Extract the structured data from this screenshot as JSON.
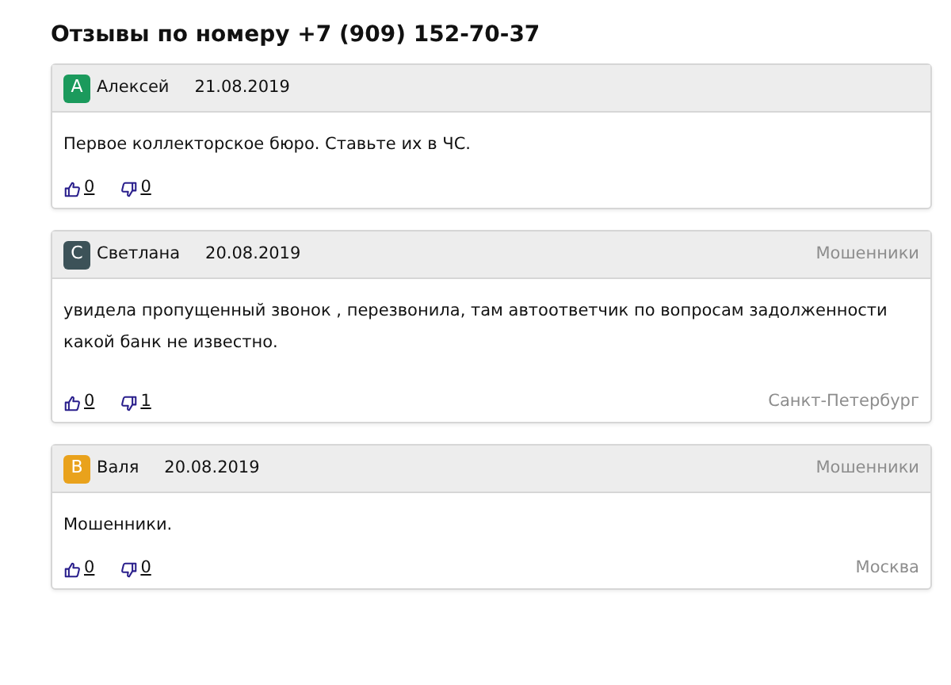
{
  "heading": "Отзывы по номеру +7 (909) 152-70-37",
  "reviews": [
    {
      "initial": "А",
      "color": "#1b9a5c",
      "author": "Алексей",
      "date": "21.08.2019",
      "text": "Первое коллекторское бюро. Ставьте их в ЧС.",
      "likes": "0",
      "dislikes": "0"
    },
    {
      "initial": "С",
      "color": "#3c5258",
      "author": "Светлана",
      "date": "20.08.2019",
      "category": "Мошенники",
      "text": "увидела пропущенный звонок , перезвонила, там автоответчик по вопросам задолженности какой банк не известно.",
      "likes": "0",
      "dislikes": "1",
      "city": "Санкт-Петербург"
    },
    {
      "initial": "В",
      "color": "#e9a21c",
      "author": "Валя",
      "date": "20.08.2019",
      "category": "Мошенники",
      "text": "Мошенники.",
      "likes": "0",
      "dislikes": "0",
      "city": "Москва"
    }
  ]
}
